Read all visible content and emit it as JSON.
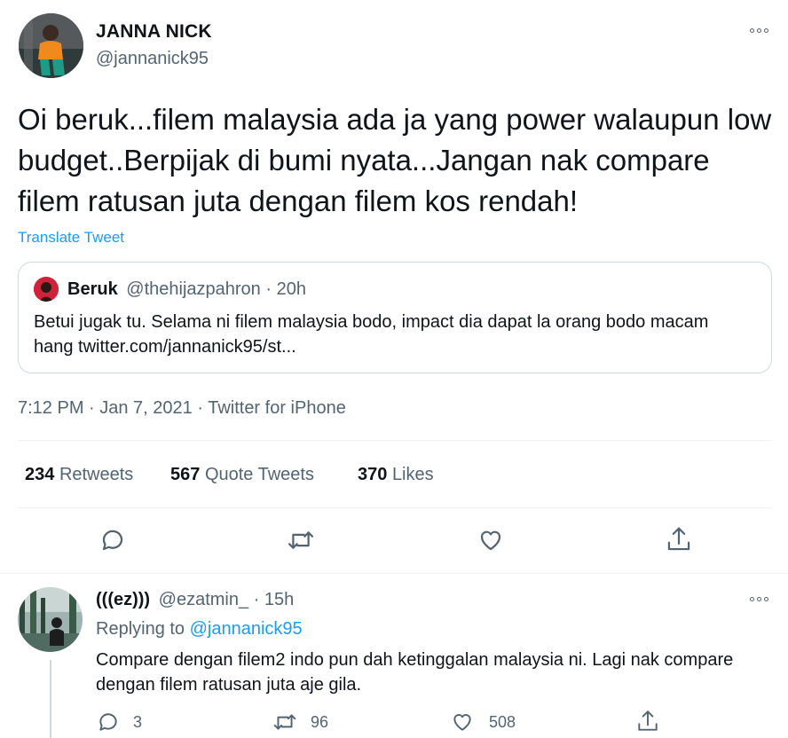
{
  "tweet": {
    "author_name": "JANNA NICK",
    "author_handle": "@jannanick95",
    "text": "Oi beruk...filem malaysia ada ja yang power walaupun low budget..Berpijak di bumi nyata...Jangan nak compare filem ratusan juta dengan filem kos rendah!",
    "translate_label": "Translate Tweet",
    "timestamp": "7:12 PM · Jan 7, 2021 · Twitter for iPhone",
    "stats": {
      "retweets_count": "234",
      "retweets_label": "Retweets",
      "quotes_count": "567",
      "quotes_label": "Quote Tweets",
      "likes_count": "370",
      "likes_label": "Likes"
    }
  },
  "quoted": {
    "author_name": "Beruk",
    "author_handle": "@thehijazpahron",
    "separator": "·",
    "time": "20h",
    "text": "Betui jugak tu. Selama ni filem malaysia bodo, impact dia dapat la orang bodo macam hang twitter.com/jannanick95/st..."
  },
  "reply": {
    "author_name": "(((ez)))",
    "author_handle": "@ezatmin_",
    "separator": "·",
    "time": "15h",
    "replying_prefix": "Replying to",
    "replying_to": "@jannanick95",
    "text": "Compare dengan filem2 indo pun dah ketinggalan malaysia ni. Lagi nak compare dengan filem ratusan juta aje gila.",
    "reply_count": "3",
    "retweet_count": "96",
    "like_count": "508"
  },
  "icons": [
    "more-icon",
    "reply-icon",
    "retweet-icon",
    "like-icon",
    "share-icon"
  ],
  "colors": {
    "link": "#1d9bf0",
    "muted": "#536471",
    "text": "#0f1419",
    "border": "#cfd9de"
  }
}
